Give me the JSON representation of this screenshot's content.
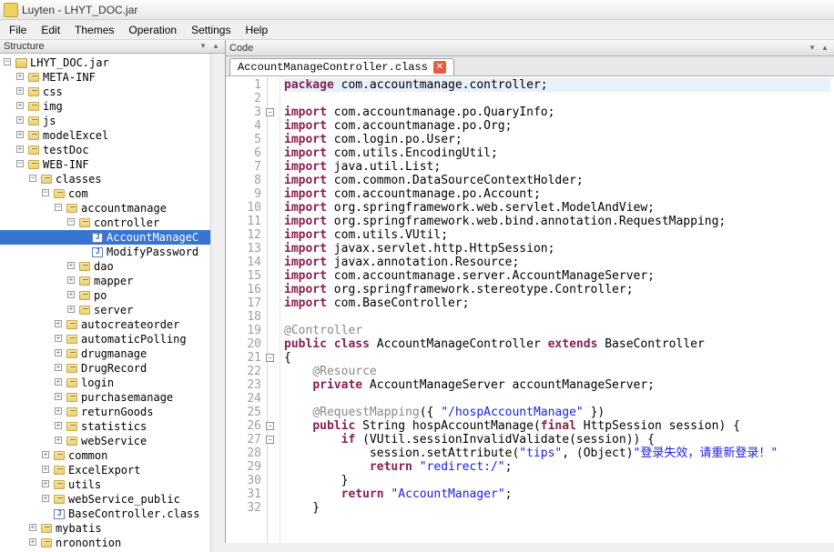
{
  "window": {
    "title": "Luyten - LHYT_DOC.jar"
  },
  "menu": [
    "File",
    "Edit",
    "Themes",
    "Operation",
    "Settings",
    "Help"
  ],
  "structure": {
    "title": "Structure",
    "nodes": [
      {
        "d": 0,
        "e": "-",
        "i": "jar",
        "t": "LHYT_DOC.jar"
      },
      {
        "d": 1,
        "e": "+",
        "i": "pkg",
        "t": "META-INF"
      },
      {
        "d": 1,
        "e": "+",
        "i": "pkg",
        "t": "css"
      },
      {
        "d": 1,
        "e": "+",
        "i": "pkg",
        "t": "img"
      },
      {
        "d": 1,
        "e": "+",
        "i": "pkg",
        "t": "js"
      },
      {
        "d": 1,
        "e": "+",
        "i": "pkg",
        "t": "modelExcel"
      },
      {
        "d": 1,
        "e": "+",
        "i": "pkg",
        "t": "testDoc"
      },
      {
        "d": 1,
        "e": "-",
        "i": "pkg",
        "t": "WEB-INF"
      },
      {
        "d": 2,
        "e": "-",
        "i": "pkg",
        "t": "classes"
      },
      {
        "d": 3,
        "e": "-",
        "i": "pkg",
        "t": "com"
      },
      {
        "d": 4,
        "e": "-",
        "i": "pkg",
        "t": "accountmanage"
      },
      {
        "d": 5,
        "e": "-",
        "i": "pkg",
        "t": "controller"
      },
      {
        "d": 6,
        "e": "",
        "i": "cls",
        "t": "AccountManageC",
        "sel": true
      },
      {
        "d": 6,
        "e": "",
        "i": "cls",
        "t": "ModifyPassword"
      },
      {
        "d": 5,
        "e": "+",
        "i": "pkg",
        "t": "dao"
      },
      {
        "d": 5,
        "e": "+",
        "i": "pkg",
        "t": "mapper"
      },
      {
        "d": 5,
        "e": "+",
        "i": "pkg",
        "t": "po"
      },
      {
        "d": 5,
        "e": "+",
        "i": "pkg",
        "t": "server"
      },
      {
        "d": 4,
        "e": "+",
        "i": "pkg",
        "t": "autocreateorder"
      },
      {
        "d": 4,
        "e": "+",
        "i": "pkg",
        "t": "automaticPolling"
      },
      {
        "d": 4,
        "e": "+",
        "i": "pkg",
        "t": "drugmanage"
      },
      {
        "d": 4,
        "e": "+",
        "i": "pkg",
        "t": "DrugRecord"
      },
      {
        "d": 4,
        "e": "+",
        "i": "pkg",
        "t": "login"
      },
      {
        "d": 4,
        "e": "+",
        "i": "pkg",
        "t": "purchasemanage"
      },
      {
        "d": 4,
        "e": "+",
        "i": "pkg",
        "t": "returnGoods"
      },
      {
        "d": 4,
        "e": "+",
        "i": "pkg",
        "t": "statistics"
      },
      {
        "d": 4,
        "e": "+",
        "i": "pkg",
        "t": "webService"
      },
      {
        "d": 3,
        "e": "+",
        "i": "pkg",
        "t": "common"
      },
      {
        "d": 3,
        "e": "+",
        "i": "pkg",
        "t": "ExcelExport"
      },
      {
        "d": 3,
        "e": "+",
        "i": "pkg",
        "t": "utils"
      },
      {
        "d": 3,
        "e": "+",
        "i": "pkg",
        "t": "webService_public"
      },
      {
        "d": 3,
        "e": "",
        "i": "cls",
        "t": "BaseController.class"
      },
      {
        "d": 2,
        "e": "+",
        "i": "pkg",
        "t": "mybatis"
      },
      {
        "d": 2,
        "e": "+",
        "i": "pkg",
        "t": "nronontion"
      }
    ]
  },
  "editor": {
    "title": "Code",
    "tab": "AccountManageController.class",
    "lines": [
      {
        "n": 1,
        "hl": true,
        "seg": [
          [
            "kw",
            "package"
          ],
          [
            "",
            " com.accountmanage.controller;"
          ]
        ]
      },
      {
        "n": 2,
        "seg": []
      },
      {
        "n": 3,
        "fold": "-",
        "seg": [
          [
            "kw",
            "import"
          ],
          [
            "",
            " com.accountmanage.po.QuaryInfo;"
          ]
        ]
      },
      {
        "n": 4,
        "seg": [
          [
            "kw",
            "import"
          ],
          [
            "",
            " com.accountmanage.po.Org;"
          ]
        ]
      },
      {
        "n": 5,
        "seg": [
          [
            "kw",
            "import"
          ],
          [
            "",
            " com.login.po.User;"
          ]
        ]
      },
      {
        "n": 6,
        "seg": [
          [
            "kw",
            "import"
          ],
          [
            "",
            " com.utils.EncodingUtil;"
          ]
        ]
      },
      {
        "n": 7,
        "seg": [
          [
            "kw",
            "import"
          ],
          [
            "",
            " java.util.List;"
          ]
        ]
      },
      {
        "n": 8,
        "seg": [
          [
            "kw",
            "import"
          ],
          [
            "",
            " com.common.DataSourceContextHolder;"
          ]
        ]
      },
      {
        "n": 9,
        "seg": [
          [
            "kw",
            "import"
          ],
          [
            "",
            " com.accountmanage.po.Account;"
          ]
        ]
      },
      {
        "n": 10,
        "seg": [
          [
            "kw",
            "import"
          ],
          [
            "",
            " org.springframework.web.servlet.ModelAndView;"
          ]
        ]
      },
      {
        "n": 11,
        "seg": [
          [
            "kw",
            "import"
          ],
          [
            "",
            " org.springframework.web.bind.annotation.RequestMapping;"
          ]
        ]
      },
      {
        "n": 12,
        "seg": [
          [
            "kw",
            "import"
          ],
          [
            "",
            " com.utils.VUtil;"
          ]
        ]
      },
      {
        "n": 13,
        "seg": [
          [
            "kw",
            "import"
          ],
          [
            "",
            " javax.servlet.http.HttpSession;"
          ]
        ]
      },
      {
        "n": 14,
        "seg": [
          [
            "kw",
            "import"
          ],
          [
            "",
            " javax.annotation.Resource;"
          ]
        ]
      },
      {
        "n": 15,
        "seg": [
          [
            "kw",
            "import"
          ],
          [
            "",
            " com.accountmanage.server.AccountManageServer;"
          ]
        ]
      },
      {
        "n": 16,
        "seg": [
          [
            "kw",
            "import"
          ],
          [
            "",
            " org.springframework.stereotype.Controller;"
          ]
        ]
      },
      {
        "n": 17,
        "seg": [
          [
            "kw",
            "import"
          ],
          [
            "",
            " com.BaseController;"
          ]
        ]
      },
      {
        "n": 18,
        "seg": []
      },
      {
        "n": 19,
        "seg": [
          [
            "ann",
            "@Controller"
          ]
        ]
      },
      {
        "n": 20,
        "seg": [
          [
            "kw",
            "public"
          ],
          [
            "",
            " "
          ],
          [
            "kw",
            "class"
          ],
          [
            "",
            " AccountManageController "
          ],
          [
            "kw",
            "extends"
          ],
          [
            "",
            " BaseController"
          ]
        ]
      },
      {
        "n": 21,
        "fold": "-",
        "seg": [
          [
            "",
            "{"
          ]
        ]
      },
      {
        "n": 22,
        "seg": [
          [
            "",
            "    "
          ],
          [
            "ann",
            "@Resource"
          ]
        ]
      },
      {
        "n": 23,
        "seg": [
          [
            "",
            "    "
          ],
          [
            "kw",
            "private"
          ],
          [
            "",
            " AccountManageServer accountManageServer;"
          ]
        ]
      },
      {
        "n": 24,
        "seg": [
          [
            "",
            "    "
          ]
        ]
      },
      {
        "n": 25,
        "seg": [
          [
            "",
            "    "
          ],
          [
            "ann",
            "@RequestMapping"
          ],
          [
            "",
            "({ "
          ],
          [
            "str",
            "\"/hospAccountManage\""
          ],
          [
            "",
            " })"
          ]
        ]
      },
      {
        "n": 26,
        "fold": "-",
        "seg": [
          [
            "",
            "    "
          ],
          [
            "kw",
            "public"
          ],
          [
            "",
            " String hospAccountManage("
          ],
          [
            "kw",
            "final"
          ],
          [
            "",
            " HttpSession session) {"
          ]
        ]
      },
      {
        "n": 27,
        "fold": "-",
        "seg": [
          [
            "",
            "        "
          ],
          [
            "kw",
            "if"
          ],
          [
            "",
            " (VUtil.sessionInvalidValidate(session)) {"
          ]
        ]
      },
      {
        "n": 28,
        "seg": [
          [
            "",
            "            session.setAttribute("
          ],
          [
            "str",
            "\"tips\""
          ],
          [
            "",
            ", (Object)"
          ],
          [
            "str",
            "\"登录失效，请重新登录！\""
          ]
        ]
      },
      {
        "n": 29,
        "seg": [
          [
            "",
            "            "
          ],
          [
            "kw",
            "return"
          ],
          [
            "",
            " "
          ],
          [
            "str",
            "\"redirect:/\""
          ],
          [
            "",
            ";"
          ]
        ]
      },
      {
        "n": 30,
        "seg": [
          [
            "",
            "        }"
          ]
        ]
      },
      {
        "n": 31,
        "seg": [
          [
            "",
            "        "
          ],
          [
            "kw",
            "return"
          ],
          [
            "",
            " "
          ],
          [
            "str",
            "\"AccountManager\""
          ],
          [
            "",
            ";"
          ]
        ]
      },
      {
        "n": 32,
        "seg": [
          [
            "",
            "    }"
          ]
        ]
      }
    ]
  }
}
